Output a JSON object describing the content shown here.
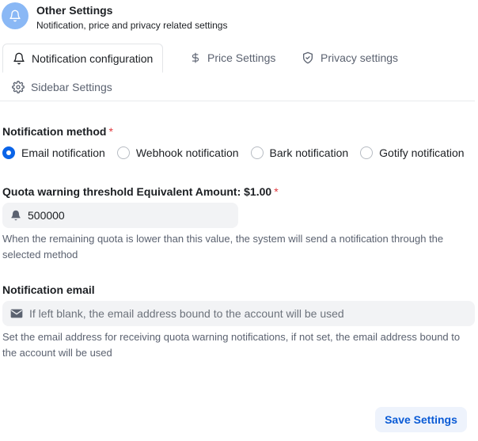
{
  "header": {
    "title": "Other Settings",
    "subtitle": "Notification, price and privacy related settings",
    "icon": "bell-icon",
    "icon_bg": "#8ab8f5"
  },
  "tabs": [
    {
      "label": "Notification configuration",
      "icon": "bell-icon",
      "active": true
    },
    {
      "label": "Price Settings",
      "icon": "dollar-icon",
      "active": false
    },
    {
      "label": "Privacy settings",
      "icon": "shield-icon",
      "active": false
    },
    {
      "label": "Sidebar Settings",
      "icon": "gear-icon",
      "active": false
    }
  ],
  "notification_method": {
    "label": "Notification method",
    "required_mark": "*",
    "options": [
      {
        "label": "Email notification",
        "checked": true
      },
      {
        "label": "Webhook notification",
        "checked": false
      },
      {
        "label": "Bark notification",
        "checked": false
      },
      {
        "label": "Gotify notification",
        "checked": false
      }
    ]
  },
  "quota": {
    "label": "Quota warning threshold Equivalent Amount: $1.00",
    "required_mark": "*",
    "value": "500000",
    "help": "When the remaining quota is lower than this value, the system will send a notification through the selected method"
  },
  "email": {
    "label": "Notification email",
    "placeholder": "If left blank, the email address bound to the account will be used",
    "help": "Set the email address for receiving quota warning notifications, if not set, the email address bound to the account will be used"
  },
  "actions": {
    "save_label": "Save Settings"
  },
  "colors": {
    "accent": "#0a64e8",
    "required": "#e0393e"
  }
}
